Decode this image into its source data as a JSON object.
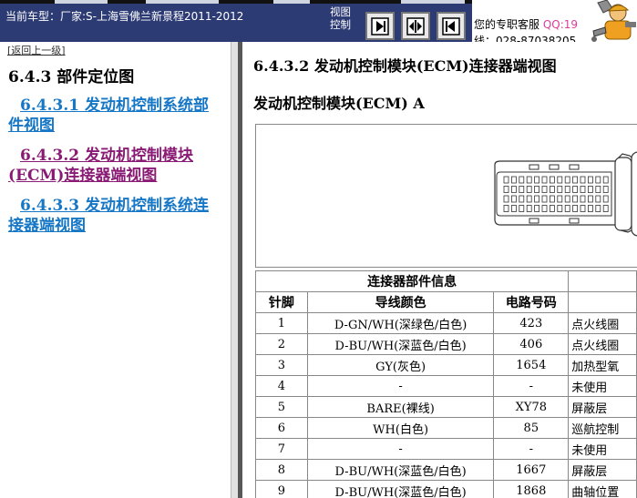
{
  "header": {
    "car_label": "当前车型：厂家:S-上海雪佛兰新景程2011-2012",
    "view_control_line1": "视图",
    "view_control_line2": "控制",
    "view_control_cut": " ",
    "service_text": "您的专职客服",
    "service_qq": "QQ:19",
    "service_phone": "线：028-87038205"
  },
  "left": {
    "back_link": "[返回上一级]",
    "section_title": "6.4.3 部件定位图",
    "items": [
      {
        "label": "6.4.3.1 发动机控制系统部件视图",
        "state": "link"
      },
      {
        "label": "6.4.3.2 发动机控制模块(ECM)连接器端视图",
        "state": "visited"
      },
      {
        "label": "6.4.3.3 发动机控制系统连接器端视图",
        "state": "link"
      }
    ]
  },
  "content": {
    "title": "6.4.3.2 发动机控制模块(ECM)连接器端视图",
    "subtitle": "发动机控制模块(ECM) A",
    "table": {
      "info_header": "连接器部件信息",
      "col_pin": "针脚",
      "col_wire": "导线颜色",
      "col_circuit": "电路号码",
      "rows": [
        {
          "pin": "1",
          "wire": "D-GN/WH(深绿色/白色)",
          "circuit": "423",
          "function": "点火线圈"
        },
        {
          "pin": "2",
          "wire": "D-BU/WH(深蓝色/白色)",
          "circuit": "406",
          "function": "点火线圈"
        },
        {
          "pin": "3",
          "wire": "GY(灰色)",
          "circuit": "1654",
          "function": "加热型氧"
        },
        {
          "pin": "4",
          "wire": "-",
          "circuit": "-",
          "function": "未使用"
        },
        {
          "pin": "5",
          "wire": "BARE(裸线)",
          "circuit": "XY78",
          "function": "屏蔽层"
        },
        {
          "pin": "6",
          "wire": "WH(白色)",
          "circuit": "85",
          "function": "巡航控制"
        },
        {
          "pin": "7",
          "wire": "-",
          "circuit": "-",
          "function": "未使用"
        },
        {
          "pin": "8",
          "wire": "D-BU/WH(深蓝色/白色)",
          "circuit": "1667",
          "function": "屏蔽层"
        },
        {
          "pin": "9",
          "wire": "D-BU/WH(深蓝色/白色)",
          "circuit": "1868",
          "function": "曲轴位置"
        }
      ]
    }
  }
}
